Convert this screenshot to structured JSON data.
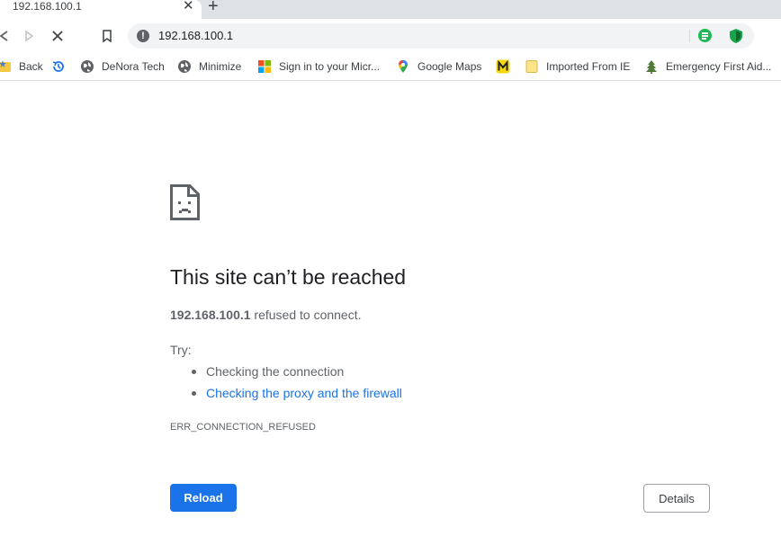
{
  "tab": {
    "title": "192.168.100.1",
    "close_glyph": "✕",
    "new_tab_glyph": "+"
  },
  "toolbar": {
    "icons": [
      "back-icon",
      "forward-icon",
      "stop-icon",
      "bookmark-icon"
    ],
    "address": "192.168.100.1",
    "site_info_glyph": "!"
  },
  "bookmarks": [
    {
      "label": "Back",
      "icon": "folder-star-icon"
    },
    {
      "label": "",
      "icon": "history-icon"
    },
    {
      "label": "DeNora Tech",
      "icon": "globe-icon"
    },
    {
      "label": "Minimize",
      "icon": "globe-icon"
    },
    {
      "label": "Sign in to your Micr...",
      "icon": "microsoft-icon"
    },
    {
      "label": "Google Maps",
      "icon": "maps-pin-icon"
    },
    {
      "label": "",
      "icon": "m-logo-icon"
    },
    {
      "label": "Imported From IE",
      "icon": "folder-icon"
    },
    {
      "label": "Emergency First Aid...",
      "icon": "tree-icon"
    }
  ],
  "error": {
    "title": "This site can’t be reached",
    "host": "192.168.100.1",
    "description_suffix": " refused to connect.",
    "try_label": "Try:",
    "suggestions": [
      "Checking the connection",
      "Checking the proxy and the firewall"
    ],
    "code": "ERR_CONNECTION_REFUSED",
    "reload_label": "Reload",
    "details_label": "Details"
  },
  "colors": {
    "accent": "#1a73e8",
    "tabstrip": "#dee1e6",
    "text_secondary": "#5f6368"
  }
}
